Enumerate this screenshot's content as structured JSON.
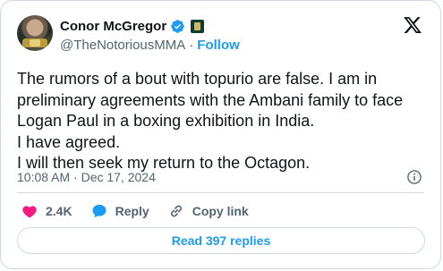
{
  "author": {
    "name": "Conor McGregor",
    "handle": "@TheNotoriousMMA",
    "separator": "·",
    "follow_label": "Follow"
  },
  "tweet": {
    "lines": [
      "The rumors of a bout with topurio are false. I am in",
      "preliminary agreements with the Ambani family to face",
      "Logan Paul in a boxing exhibition in India.",
      "I have agreed.",
      "I will then seek my return to the Octagon."
    ],
    "timestamp": "10:08 AM · Dec 17, 2024"
  },
  "actions": {
    "likes": "2.4K",
    "reply_label": "Reply",
    "copy_link_label": "Copy link"
  },
  "read_replies_label": "Read 397 replies",
  "colors": {
    "accent": "#1d9bf0",
    "like": "#f91880",
    "text": "#0f1419",
    "muted": "#536471"
  }
}
